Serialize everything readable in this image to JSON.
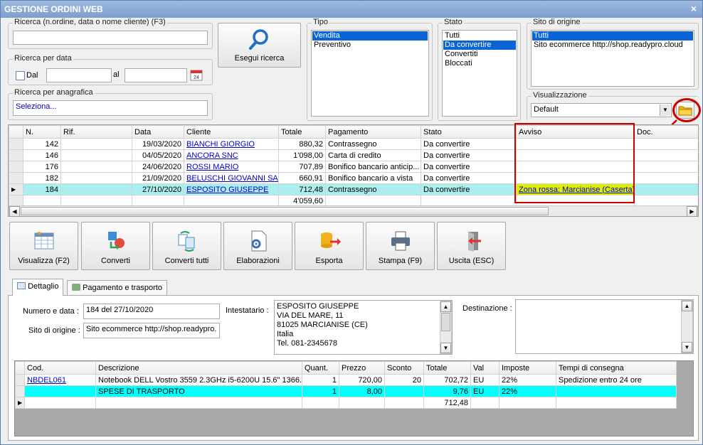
{
  "window": {
    "title": "GESTIONE ORDINI WEB",
    "close": "×"
  },
  "search": {
    "main_label": "Ricerca (n.ordine, data o nome cliente) (F3)",
    "main_value": "",
    "date_group": "Ricerca per data",
    "dal": "Dal",
    "al": "al",
    "anag_group": "Ricerca per anagrafica",
    "anag_value": "Seleziona...",
    "button": "Esegui ricerca"
  },
  "tipo": {
    "label": "Tipo",
    "items": [
      "Vendita",
      "Preventivo"
    ],
    "selected": 0
  },
  "stato": {
    "label": "Stato",
    "items": [
      "Tutti",
      "Da convertire",
      "Convertiti",
      "Bloccati"
    ],
    "selected": 1
  },
  "sito": {
    "label": "Sito di origine",
    "items": [
      "Tutti",
      "Sito ecommerce http://shop.readypro.cloud"
    ],
    "selected": 0
  },
  "visualizzazione": {
    "label": "Visualizzazione",
    "value": "Default"
  },
  "orders": {
    "columns": [
      "N.",
      "Rif.",
      "Data",
      "Cliente",
      "Totale",
      "Pagamento",
      "Stato",
      "Avviso",
      "Doc."
    ],
    "rows": [
      {
        "n": "142",
        "rif": "",
        "data": "19/03/2020",
        "cliente": "BIANCHI GIORGIO",
        "totale": "880,32",
        "pagamento": "Contrassegno",
        "stato": "Da convertire",
        "avviso": "",
        "doc": ""
      },
      {
        "n": "146",
        "rif": "",
        "data": "04/05/2020",
        "cliente": "ANCORA SNC",
        "totale": "1'098,00",
        "pagamento": "Carta di credito",
        "stato": "Da convertire",
        "avviso": "",
        "doc": ""
      },
      {
        "n": "176",
        "rif": "",
        "data": "24/06/2020",
        "cliente": "ROSSI MARIO",
        "totale": "707,89",
        "pagamento": "Bonifico bancario anticip...",
        "stato": "Da convertire",
        "avviso": "",
        "doc": ""
      },
      {
        "n": "182",
        "rif": "",
        "data": "21/09/2020",
        "cliente": "BELUSCHI GIOVANNI SAS",
        "totale": "660,91",
        "pagamento": "Bonifico bancario a vista",
        "stato": "Da convertire",
        "avviso": "",
        "doc": ""
      },
      {
        "n": "184",
        "rif": "",
        "data": "27/10/2020",
        "cliente": "ESPOSITO GIUSEPPE",
        "totale": "712,48",
        "pagamento": "Contrassegno",
        "stato": "Da convertire",
        "avviso": "Zona rossa: Marcianise (Caserta)",
        "doc": ""
      }
    ],
    "total": "4'059,60"
  },
  "toolbar": {
    "visualizza": "Visualizza (F2)",
    "converti": "Converti",
    "converti_tutti": "Converti tutti",
    "elaborazioni": "Elaborazioni",
    "esporta": "Esporta",
    "stampa": "Stampa (F9)",
    "uscita": "Uscita (ESC)"
  },
  "tabs": {
    "dettaglio": "Dettaglio",
    "pagamento": "Pagamento e trasporto"
  },
  "detail": {
    "numero_label": "Numero e data :",
    "numero_value": "184 del 27/10/2020",
    "sito_label": "Sito di origine :",
    "sito_value": "Sito ecommerce http://shop.readypro.",
    "intestatario_label": "Intestatario :",
    "intestatario_lines": [
      "ESPOSITO GIUSEPPE",
      "VIA DEL MARE, 11",
      "81025 MARCIANISE (CE)",
      "Italia",
      "Tel. 081-2345678"
    ],
    "destinazione_label": "Destinazione :"
  },
  "lines": {
    "columns": [
      "Cod.",
      "Descrizione",
      "Quant.",
      "Prezzo",
      "Sconto",
      "Totale",
      "Val",
      "Imposte",
      "Tempi di consegna"
    ],
    "rows": [
      {
        "cod": "NBDEL061",
        "desc": "Notebook DELL Vostro 3559 2.3GHz i5-6200U 15.6\" 1366...",
        "quant": "1",
        "prezzo": "720,00",
        "sconto": "20",
        "totale": "702,72",
        "val": "EU",
        "imposte": "22%",
        "tempi": "Spedizione entro 24 ore"
      },
      {
        "cod": "",
        "desc": "SPESE DI TRASPORTO",
        "quant": "1",
        "prezzo": "8,00",
        "sconto": "",
        "totale": "9,76",
        "val": "EU",
        "imposte": "22%",
        "tempi": ""
      }
    ],
    "total": "712,48"
  },
  "colors": {
    "selected_list": "#0a64d6",
    "highlight_row": "#aaeeee",
    "cyan_row": "#00ffff",
    "avviso_bg": "#ddee00",
    "annotation": "#cc0000"
  }
}
